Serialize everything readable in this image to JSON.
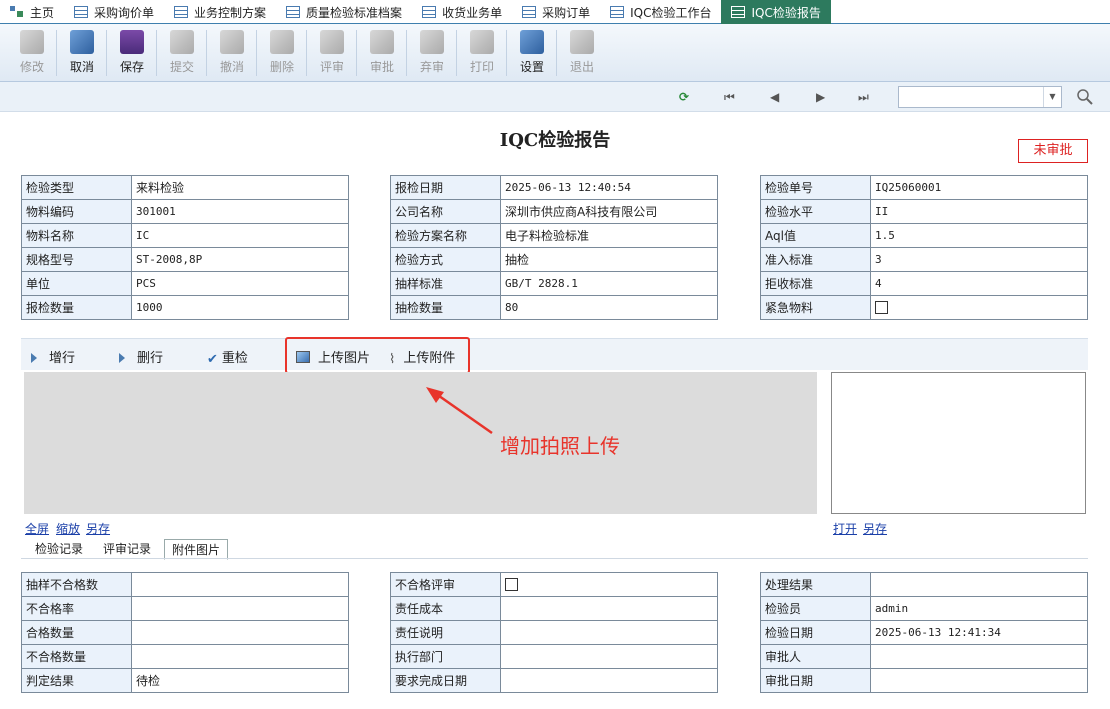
{
  "tabs": [
    {
      "label": "主页",
      "icon": "home-icon"
    },
    {
      "label": "采购询价单",
      "icon": "table-icon"
    },
    {
      "label": "业务控制方案",
      "icon": "table-icon"
    },
    {
      "label": "质量检验标准档案",
      "icon": "table-icon"
    },
    {
      "label": "收货业务单",
      "icon": "table-icon"
    },
    {
      "label": "采购订单",
      "icon": "table-icon"
    },
    {
      "label": "IQC检验工作台",
      "icon": "table-icon"
    },
    {
      "label": "IQC检验报告",
      "icon": "table-icon",
      "active": true
    }
  ],
  "toolbar": {
    "edit": "修改",
    "cancel": "取消",
    "save": "保存",
    "submit": "提交",
    "revoke": "撤消",
    "delete": "删除",
    "review": "评审",
    "approve": "审批",
    "abandon": "弃审",
    "print": "打印",
    "settings": "设置",
    "exit": "退出"
  },
  "report": {
    "title": "IQC检验报告",
    "status": "未审批"
  },
  "fields_left": [
    {
      "label": "检验类型",
      "value": "来料检验"
    },
    {
      "label": "物料编码",
      "value": "301001"
    },
    {
      "label": "物料名称",
      "value": "IC"
    },
    {
      "label": "规格型号",
      "value": "ST-2008,8P"
    },
    {
      "label": "单位",
      "value": "PCS"
    },
    {
      "label": "报检数量",
      "value": "1000"
    }
  ],
  "fields_mid": [
    {
      "label": "报检日期",
      "value": "2025-06-13 12:40:54"
    },
    {
      "label": "公司名称",
      "value": "深圳市供应商A科技有限公司"
    },
    {
      "label": "检验方案名称",
      "value": "电子料检验标准"
    },
    {
      "label": "检验方式",
      "value": "抽检"
    },
    {
      "label": "抽样标准",
      "value": "GB/T 2828.1"
    },
    {
      "label": "抽检数量",
      "value": "80"
    }
  ],
  "fields_right": [
    {
      "label": "检验单号",
      "value": "IQ25060001"
    },
    {
      "label": "检验水平",
      "value": "II"
    },
    {
      "label": "Aql值",
      "value": "1.5"
    },
    {
      "label": "准入标准",
      "value": "3"
    },
    {
      "label": "拒收标准",
      "value": "4"
    },
    {
      "label": "紧急物料",
      "value": ""
    }
  ],
  "actions": {
    "add_row": "增行",
    "delete_row": "删行",
    "recheck": "重检",
    "upload_image": "上传图片",
    "upload_attachment": "上传附件"
  },
  "image_links": {
    "fullscreen": "全屏",
    "zoom": "缩放",
    "save_as": "另存"
  },
  "attach_links": {
    "open": "打开",
    "save_as": "另存"
  },
  "annotation": "增加拍照上传",
  "subtabs": [
    "检验记录",
    "评审记录",
    "附件图片"
  ],
  "bottom_left": [
    {
      "label": "抽样不合格数",
      "value": ""
    },
    {
      "label": "不合格率",
      "value": ""
    },
    {
      "label": "合格数量",
      "value": ""
    },
    {
      "label": "不合格数量",
      "value": ""
    },
    {
      "label": "判定结果",
      "value": "待检"
    }
  ],
  "bottom_mid": [
    {
      "label": "不合格评审",
      "value": ""
    },
    {
      "label": "责任成本",
      "value": ""
    },
    {
      "label": "责任说明",
      "value": ""
    },
    {
      "label": "执行部门",
      "value": ""
    },
    {
      "label": "要求完成日期",
      "value": ""
    }
  ],
  "bottom_right": [
    {
      "label": "处理结果",
      "value": ""
    },
    {
      "label": "检验员",
      "value": "admin"
    },
    {
      "label": "检验日期",
      "value": "2025-06-13 12:41:34"
    },
    {
      "label": "审批人",
      "value": ""
    },
    {
      "label": "审批日期",
      "value": ""
    }
  ],
  "colors": {
    "accent": "#2d7a5e",
    "highlight": "#e8342b",
    "link": "#1a3fa8"
  }
}
